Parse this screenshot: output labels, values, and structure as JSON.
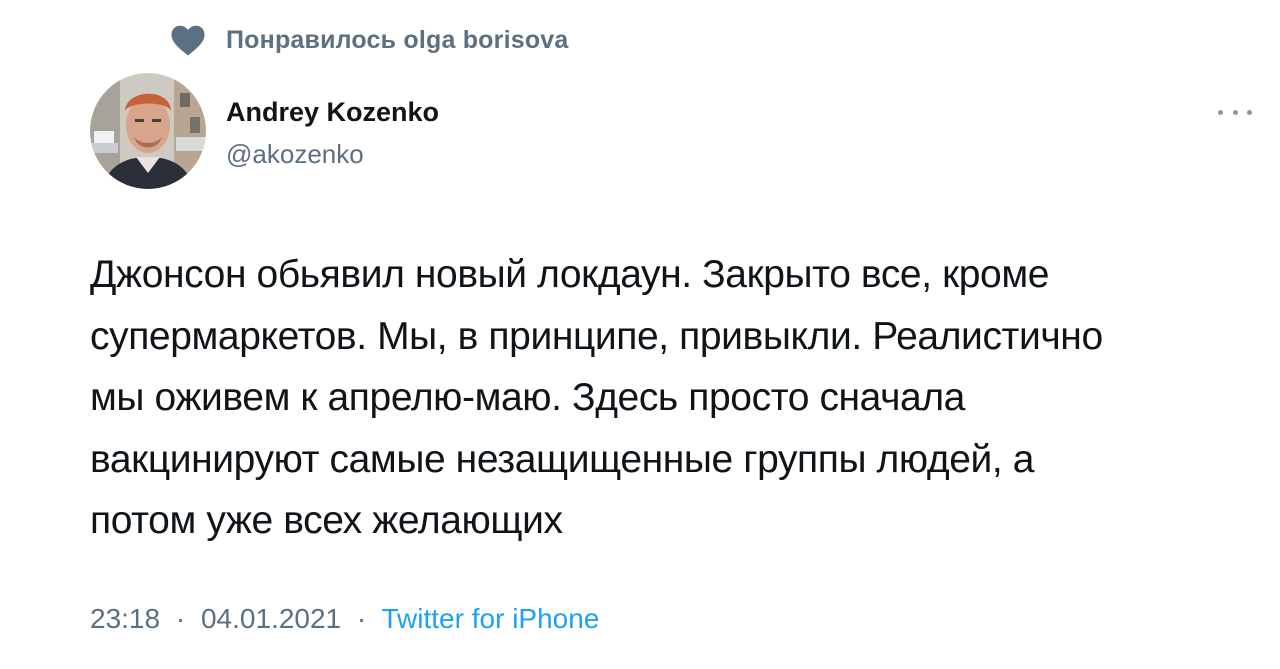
{
  "social_context": {
    "icon": "heart-icon",
    "label": "Понравилось olga borisova"
  },
  "author": {
    "name": "Andrey Kozenko",
    "handle": "@akozenko"
  },
  "tweet": {
    "text": "Джонсон обьявил новый локдаун. Закрыто все, кроме\nсупермаркетов. Мы, в принципе, привыкли. Реалистично\nмы оживем к апрелю-маю. Здесь просто сначала\nвакцинируют самые незащищенные группы людей, а\nпотом уже всех желающих",
    "time": "23:18",
    "date": "04.01.2021",
    "separator": "·",
    "source": "Twitter for iPhone"
  },
  "colors": {
    "secondary_text": "#5b7083",
    "link": "#1da1f2",
    "primary_text": "#0f1419"
  }
}
